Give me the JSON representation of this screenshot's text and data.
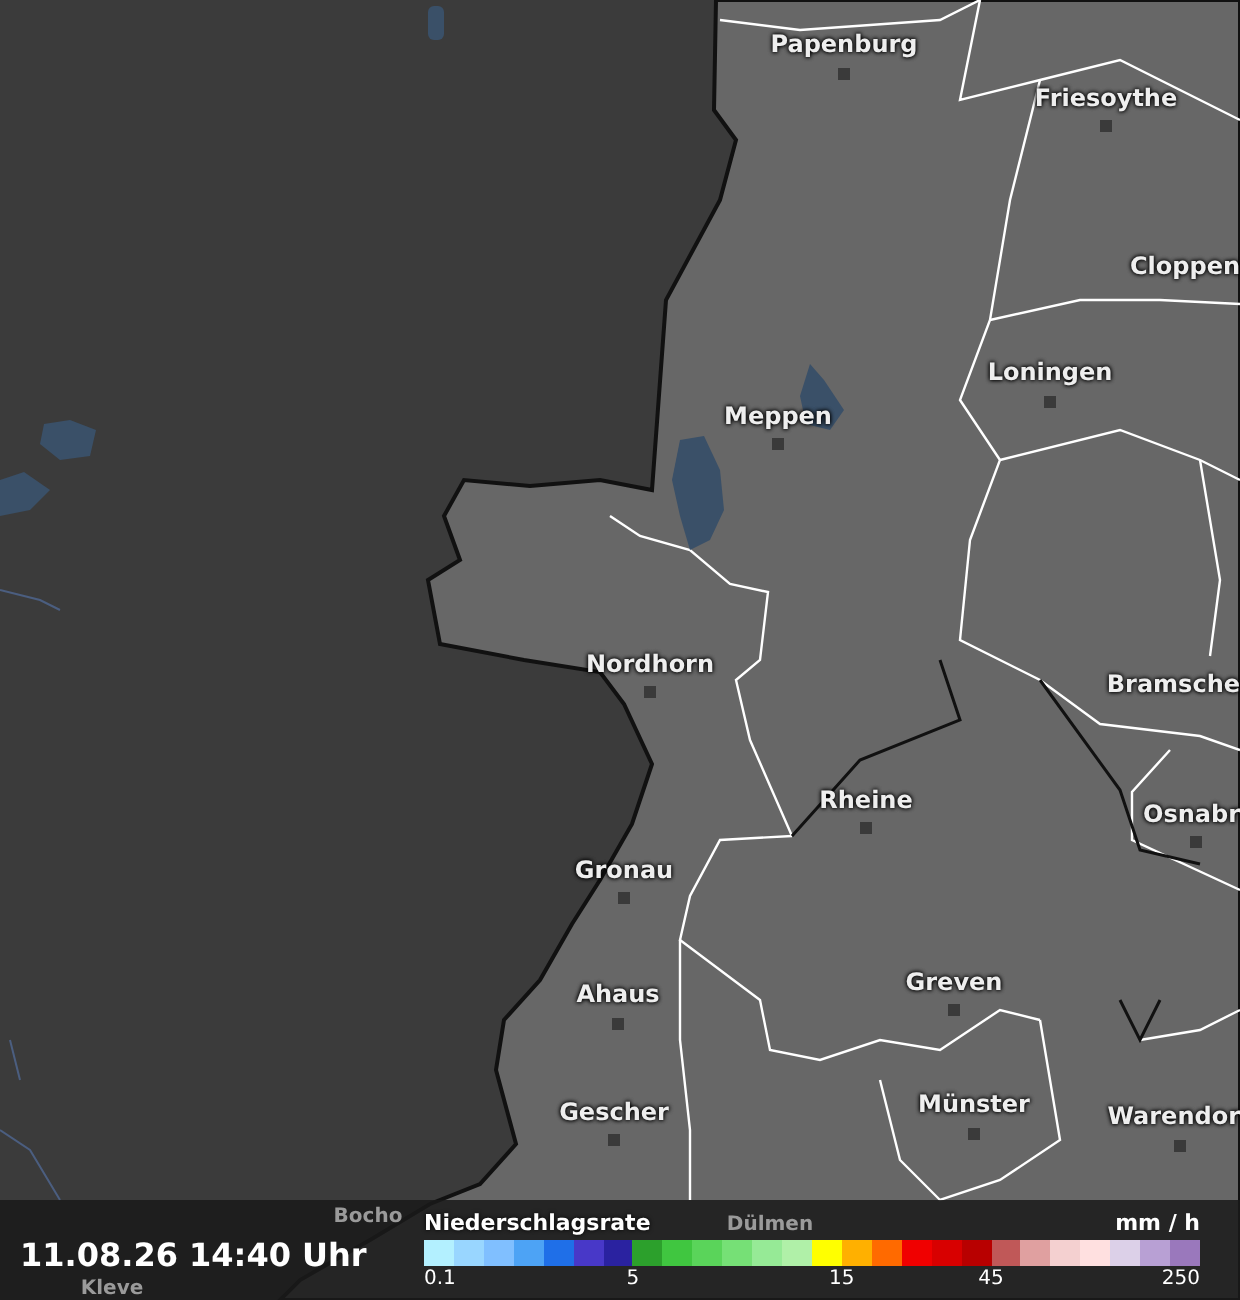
{
  "map": {
    "cities": [
      {
        "name": "Papenburg"
      },
      {
        "name": "Friesoythe"
      },
      {
        "name": "Cloppen"
      },
      {
        "name": "Meppen"
      },
      {
        "name": "Loningen"
      },
      {
        "name": "Nordhorn"
      },
      {
        "name": "Bramsche"
      },
      {
        "name": "Rheine"
      },
      {
        "name": "Osnabr"
      },
      {
        "name": "Gronau"
      },
      {
        "name": "Greven"
      },
      {
        "name": "Ahaus"
      },
      {
        "name": "Gescher"
      },
      {
        "name": "Münster"
      },
      {
        "name": "Warendor"
      },
      {
        "name": "Bocho"
      },
      {
        "name": "Dülmen"
      },
      {
        "name": "Kleve"
      }
    ]
  },
  "footer": {
    "timestamp": "11.08.26 14:40 Uhr",
    "legend": {
      "title": "Niederschlagsrate",
      "unit": "mm / h",
      "swatches": [
        {
          "color": "#b3f0ff",
          "tick": "0.1"
        },
        {
          "color": "#99d6ff"
        },
        {
          "color": "#80bfff"
        },
        {
          "color": "#4da3f5"
        },
        {
          "color": "#1f6fe8"
        },
        {
          "color": "#4838c8"
        },
        {
          "color": "#2a22a0"
        },
        {
          "color": "#2ca02c",
          "tick": "5"
        },
        {
          "color": "#40c640"
        },
        {
          "color": "#5ad45a"
        },
        {
          "color": "#76e076"
        },
        {
          "color": "#96ea96"
        },
        {
          "color": "#b0f0a8"
        },
        {
          "color": "#ffff00"
        },
        {
          "color": "#ffb000",
          "tick": "15"
        },
        {
          "color": "#ff6a00"
        },
        {
          "color": "#f00000"
        },
        {
          "color": "#d80000"
        },
        {
          "color": "#b80000"
        },
        {
          "color": "#c05858",
          "tick": "45"
        },
        {
          "color": "#e0a0a0"
        },
        {
          "color": "#f4d0d0"
        },
        {
          "color": "#ffe0e0"
        },
        {
          "color": "#dcd0e8"
        },
        {
          "color": "#b8a0d4"
        },
        {
          "color": "#9a78bc",
          "tick": "250"
        }
      ]
    }
  }
}
